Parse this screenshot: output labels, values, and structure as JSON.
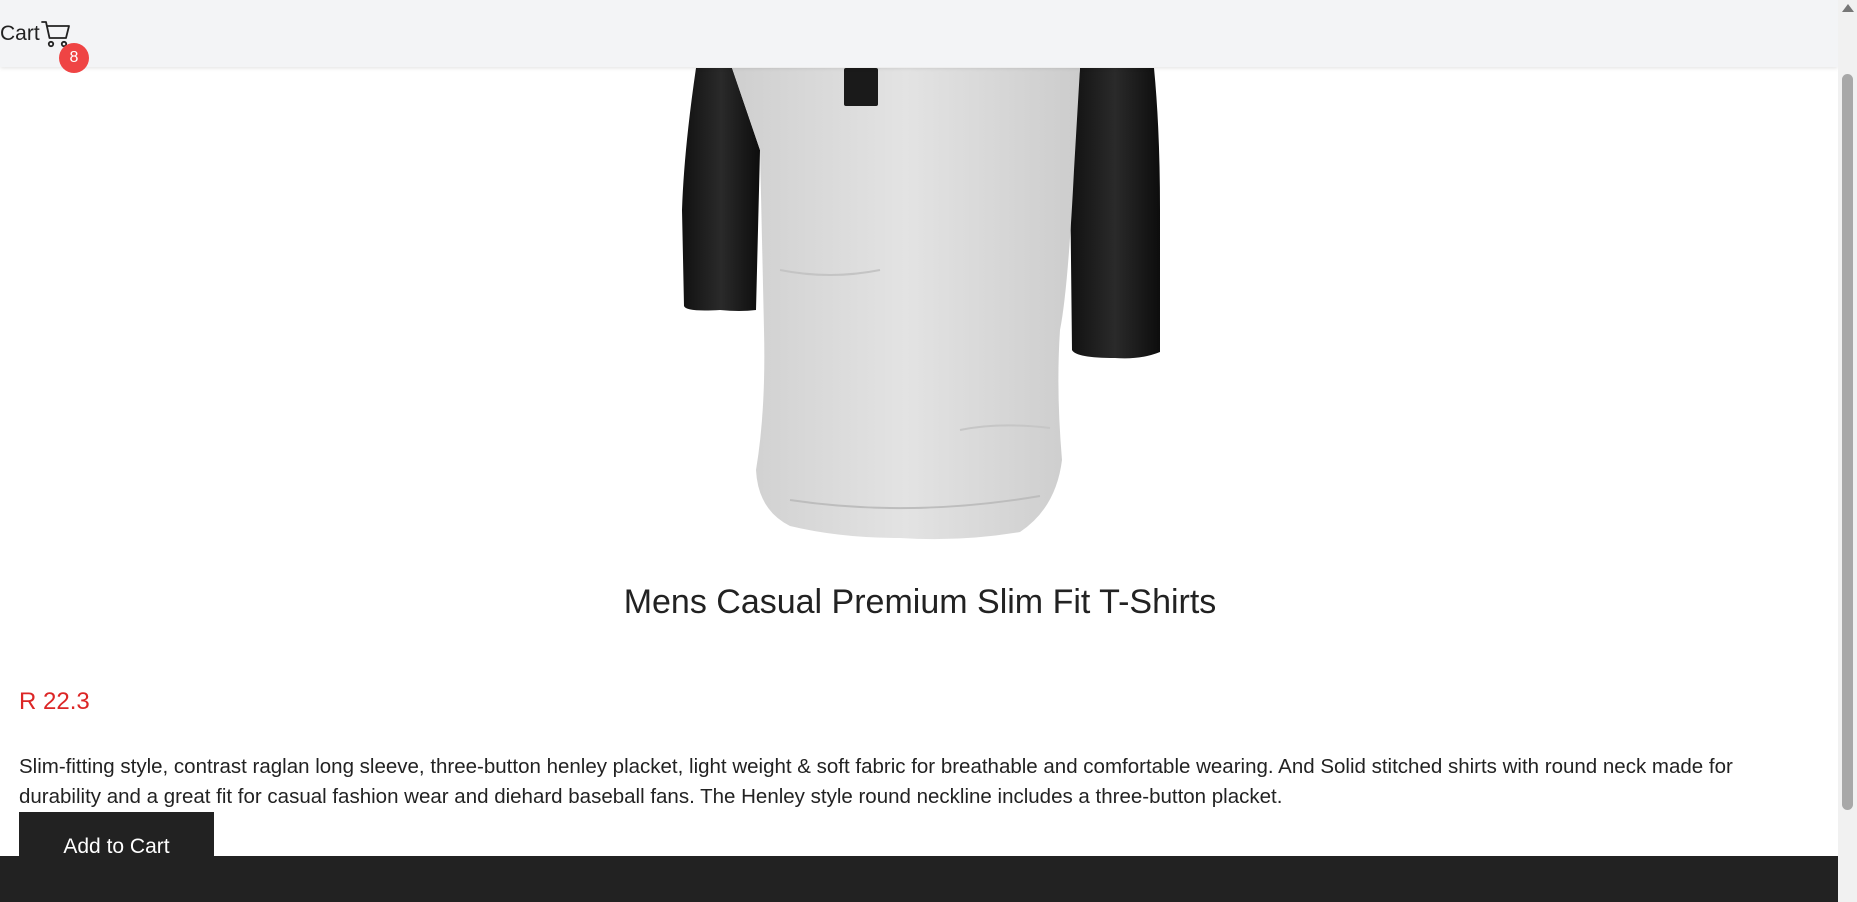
{
  "header": {
    "cart_label": "Cart",
    "cart_count": "8"
  },
  "product": {
    "image_alt": "Mens Casual Premium Slim Fit T-Shirts",
    "title": "Mens Casual Premium Slim Fit T-Shirts",
    "price": "R 22.3",
    "description": "Slim-fitting style, contrast raglan long sleeve, three-button henley placket, light weight & soft fabric for breathable and comfortable wearing. And Solid stitched shirts with round neck made for durability and a great fit for casual fashion wear and diehard baseball fans. The Henley style round neckline includes a three-button placket.",
    "add_to_cart_label": "Add to Cart"
  },
  "colors": {
    "header_bg": "#f3f4f6",
    "badge": "#ef4444",
    "price": "#dc2626",
    "button_bg": "#222222",
    "footer_bg": "#222222"
  },
  "icons": {
    "cart": "shopping-cart-icon"
  }
}
